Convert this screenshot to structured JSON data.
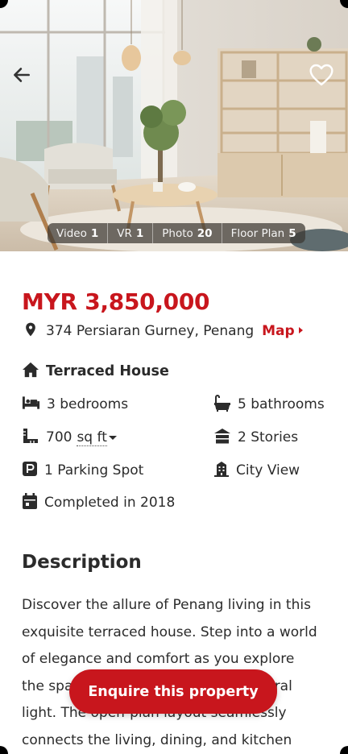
{
  "hero": {
    "back_icon": "arrow-left-icon",
    "favorite_icon": "heart-outline-icon",
    "media_tabs": [
      {
        "label": "Video",
        "count": "1"
      },
      {
        "label": "VR",
        "count": "1"
      },
      {
        "label": "Photo",
        "count": "20"
      },
      {
        "label": "Floor Plan",
        "count": "5"
      }
    ]
  },
  "listing": {
    "price": "MYR 3,850,000",
    "address": "374  Persiaran Gurney, Penang",
    "map_label": "Map",
    "property_type": "Terraced House",
    "bedrooms": "3 bedrooms",
    "bathrooms": "5 bathrooms",
    "size_value": "700",
    "size_unit": "sq ft",
    "stories": "2 Stories",
    "parking": "1 Parking Spot",
    "view": "City View",
    "completed": "Completed in 2018"
  },
  "description": {
    "title": "Description",
    "lines": [
      "Discover the allure of Penang living in this",
      "exquisite terraced house. Step into a world",
      "of elegance and comfort as you explore",
      "the spacious interiors bathed in natural",
      "light. The open-plan layout seamlessly",
      "connects the living, dining, and kitchen"
    ]
  },
  "cta": {
    "label": "Enquire this property"
  },
  "colors": {
    "accent": "#c8161d",
    "text": "#2b2b2b"
  }
}
